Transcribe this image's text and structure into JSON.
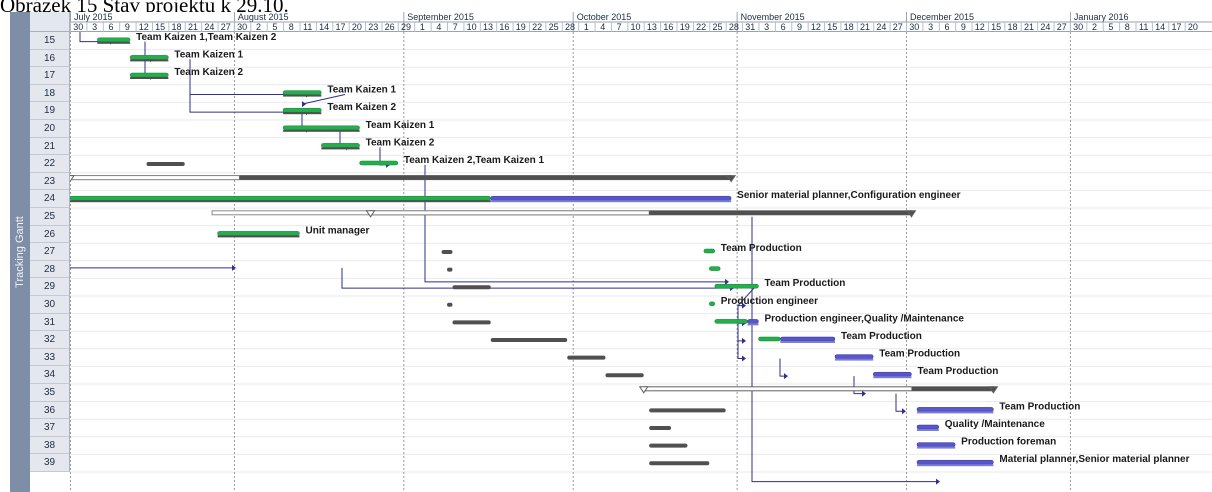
{
  "caption": "Obrázek 15 Stav projektu k 29.10.",
  "view_name": "Tracking Gantt",
  "colors": {
    "actual": "#22b04b",
    "planned": "#5757c9",
    "baseline": "#505050",
    "summary": "#505050",
    "link": "#2f2f8f",
    "rowhead": "#e4e8ee",
    "viewstrip": "#7d8ea6"
  },
  "timescale": {
    "months": [
      {
        "label": "July 2015",
        "start": "2015-06-30"
      },
      {
        "label": "August 2015",
        "start": "2015-07-30"
      },
      {
        "label": "September 2015",
        "start": "2015-08-30"
      },
      {
        "label": "October 2015",
        "start": "2015-09-30"
      },
      {
        "label": "November 2015",
        "start": "2015-10-30"
      },
      {
        "label": "December 2015",
        "start": "2015-11-30"
      },
      {
        "label": "January 2016",
        "start": "2015-12-30"
      }
    ],
    "tick_labels": [
      "30",
      "3",
      "6",
      "9",
      "12",
      "15",
      "18",
      "21",
      "24",
      "27",
      "30",
      "2",
      "5",
      "8",
      "11",
      "14",
      "17",
      "20",
      "23",
      "26",
      "29",
      "1",
      "4",
      "7",
      "10",
      "13",
      "16",
      "19",
      "22",
      "25",
      "28",
      "1",
      "4",
      "7",
      "10",
      "13",
      "16",
      "19",
      "22",
      "25",
      "28",
      "31",
      "3",
      "6",
      "9",
      "12",
      "15",
      "18",
      "21",
      "24",
      "27",
      "30",
      "3",
      "6",
      "9",
      "12",
      "15",
      "18",
      "21",
      "24",
      "27",
      "30",
      "2",
      "5",
      "8",
      "11",
      "14",
      "17",
      "20"
    ]
  },
  "rows": [
    {
      "id": "15",
      "resource": "Team Kaizen 1,Team Kaizen 2"
    },
    {
      "id": "16",
      "resource": "Team Kaizen 1"
    },
    {
      "id": "17",
      "resource": "Team Kaizen 2"
    },
    {
      "id": "18",
      "resource": "Team Kaizen 1"
    },
    {
      "id": "19",
      "resource": "Team Kaizen 2"
    },
    {
      "id": "20",
      "resource": "Team Kaizen 1"
    },
    {
      "id": "21",
      "resource": "Team Kaizen 2"
    },
    {
      "id": "22",
      "resource": "Team Kaizen 2,Team Kaizen 1"
    },
    {
      "id": "23",
      "resource": ""
    },
    {
      "id": "24",
      "resource": "Senior material planner,Configuration engineer"
    },
    {
      "id": "25",
      "resource": ""
    },
    {
      "id": "26",
      "resource": "Unit manager"
    },
    {
      "id": "27",
      "resource": "Team Production"
    },
    {
      "id": "28",
      "resource": ""
    },
    {
      "id": "29",
      "resource": "Team Production"
    },
    {
      "id": "30",
      "resource": "Production engineer"
    },
    {
      "id": "31",
      "resource": "Production engineer,Quality /Maintenance"
    },
    {
      "id": "32",
      "resource": "Team Production"
    },
    {
      "id": "33",
      "resource": "Team Production"
    },
    {
      "id": "34",
      "resource": "Team Production"
    },
    {
      "id": "35",
      "resource": ""
    },
    {
      "id": "36",
      "resource": "Team Production"
    },
    {
      "id": "37",
      "resource": "Quality /Maintenance"
    },
    {
      "id": "38",
      "resource": "Production foreman"
    },
    {
      "id": "39",
      "resource": "Material planner,Senior material planner"
    }
  ],
  "tasks": [
    {
      "row": 0,
      "type": "task",
      "baseline": [
        "2015-07-05",
        "2015-07-11"
      ],
      "actual": [
        "2015-07-05",
        "2015-07-11"
      ],
      "planned": null
    },
    {
      "row": 1,
      "type": "task",
      "baseline": [
        "2015-07-11",
        "2015-07-18"
      ],
      "actual": [
        "2015-07-11",
        "2015-07-18"
      ],
      "planned": null
    },
    {
      "row": 2,
      "type": "task",
      "baseline": [
        "2015-07-11",
        "2015-07-18"
      ],
      "actual": [
        "2015-07-11",
        "2015-07-18"
      ],
      "planned": null
    },
    {
      "row": 3,
      "type": "task",
      "baseline": [
        "2015-08-08",
        "2015-08-15"
      ],
      "actual": [
        "2015-08-08",
        "2015-08-15"
      ],
      "planned": null
    },
    {
      "row": 4,
      "type": "task",
      "baseline": [
        "2015-08-08",
        "2015-08-15"
      ],
      "actual": [
        "2015-08-08",
        "2015-08-15"
      ],
      "planned": null
    },
    {
      "row": 5,
      "type": "task",
      "baseline": [
        "2015-08-08",
        "2015-08-22"
      ],
      "actual": [
        "2015-08-08",
        "2015-08-22"
      ],
      "planned": null
    },
    {
      "row": 6,
      "type": "task",
      "baseline": [
        "2015-08-15",
        "2015-08-22"
      ],
      "actual": [
        "2015-08-15",
        "2015-08-22"
      ],
      "planned": null
    },
    {
      "row": 7,
      "type": "task",
      "baseline": [
        "2015-07-14",
        "2015-07-21"
      ],
      "actual": [
        "2015-08-22",
        "2015-08-29"
      ],
      "planned": null
    },
    {
      "row": 8,
      "type": "summary",
      "baseline": [
        "2015-06-30",
        "2015-07-31"
      ],
      "actual": [
        "2015-06-30",
        "2015-07-31"
      ],
      "planned": [
        "2015-07-31",
        "2015-10-29"
      ]
    },
    {
      "row": 9,
      "type": "task",
      "baseline": [
        "2015-06-30",
        "2015-07-31"
      ],
      "actual": [
        "2015-06-30",
        "2015-09-15"
      ],
      "planned": [
        "2015-09-15",
        "2015-10-29"
      ]
    },
    {
      "row": 10,
      "type": "summary",
      "baseline": [
        "2015-08-24",
        "2015-12-01"
      ],
      "actual": [
        "2015-07-26",
        "2015-10-14"
      ],
      "planned": [
        "2015-10-14",
        "2015-12-01"
      ]
    },
    {
      "row": 11,
      "type": "task",
      "baseline": [
        "2015-07-27",
        "2015-08-11"
      ],
      "actual": [
        "2015-07-27",
        "2015-08-11"
      ],
      "planned": null
    },
    {
      "row": 12,
      "type": "task",
      "baseline": [
        "2015-09-06",
        "2015-09-08"
      ],
      "actual": [
        "2015-10-24",
        "2015-10-26"
      ],
      "planned": null
    },
    {
      "row": 13,
      "type": "task",
      "baseline": [
        "2015-09-07",
        "2015-09-08"
      ],
      "actual": [
        "2015-10-25",
        "2015-10-27"
      ],
      "planned": null
    },
    {
      "row": 14,
      "type": "task",
      "baseline": [
        "2015-09-08",
        "2015-09-15"
      ],
      "actual": [
        "2015-10-26",
        "2015-11-03"
      ],
      "planned": null
    },
    {
      "row": 15,
      "type": "task",
      "baseline": [
        "2015-09-07",
        "2015-09-08"
      ],
      "actual": [
        "2015-10-25",
        "2015-10-26"
      ],
      "planned": null
    },
    {
      "row": 16,
      "type": "task",
      "baseline": [
        "2015-09-08",
        "2015-09-15"
      ],
      "actual": [
        "2015-10-26",
        "2015-11-01"
      ],
      "planned": [
        "2015-11-01",
        "2015-11-03"
      ]
    },
    {
      "row": 17,
      "type": "task",
      "baseline": [
        "2015-09-15",
        "2015-09-29"
      ],
      "actual": [
        "2015-11-03",
        "2015-11-07"
      ],
      "planned": [
        "2015-11-07",
        "2015-11-17"
      ]
    },
    {
      "row": 18,
      "type": "task",
      "baseline": [
        "2015-09-29",
        "2015-10-06"
      ],
      "actual": null,
      "planned": [
        "2015-11-17",
        "2015-11-24"
      ]
    },
    {
      "row": 19,
      "type": "task",
      "baseline": [
        "2015-10-06",
        "2015-10-13"
      ],
      "actual": null,
      "planned": [
        "2015-11-24",
        "2015-12-01"
      ]
    },
    {
      "row": 20,
      "type": "summary",
      "baseline": [
        "2015-10-13",
        "2015-10-28"
      ],
      "actual": null,
      "planned": [
        "2015-12-01",
        "2015-12-16"
      ]
    },
    {
      "row": 21,
      "type": "task",
      "baseline": [
        "2015-10-14",
        "2015-10-28"
      ],
      "actual": null,
      "planned": [
        "2015-12-02",
        "2015-12-16"
      ]
    },
    {
      "row": 22,
      "type": "task",
      "baseline": [
        "2015-10-14",
        "2015-10-18"
      ],
      "actual": null,
      "planned": [
        "2015-12-02",
        "2015-12-06"
      ]
    },
    {
      "row": 23,
      "type": "task",
      "baseline": [
        "2015-10-14",
        "2015-10-21"
      ],
      "actual": null,
      "planned": [
        "2015-12-02",
        "2015-12-09"
      ]
    },
    {
      "row": 24,
      "type": "task",
      "baseline": [
        "2015-10-14",
        "2015-10-25"
      ],
      "actual": null,
      "planned": [
        "2015-12-02",
        "2015-12-16"
      ]
    }
  ],
  "status_date": "2015-10-29"
}
